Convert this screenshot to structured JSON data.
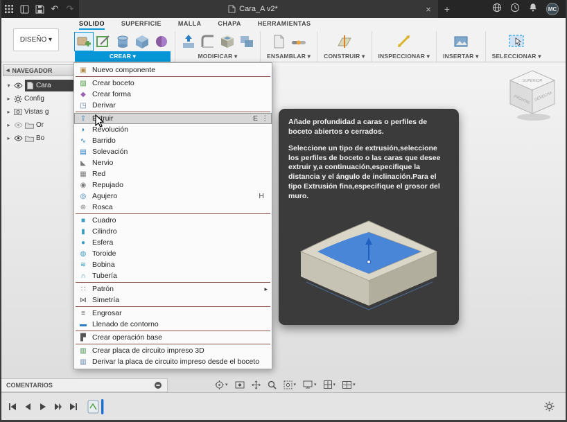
{
  "titlebar": {
    "title": "Cara_A v2*",
    "close": "×",
    "new_tab": "+",
    "avatar": "MC",
    "undo": "↶",
    "redo": "↷"
  },
  "icons": {
    "expand": "▾",
    "collapse": "▸",
    "panel_collapse": "◂",
    "caret": "▾",
    "more": "⋮",
    "submenu": "▸"
  },
  "ribbon": {
    "design_label": "DISEÑO ▾",
    "tabs": [
      {
        "label": "SOLIDO"
      },
      {
        "label": "SUPERFICIE"
      },
      {
        "label": "MALLA"
      },
      {
        "label": "CHAPA"
      },
      {
        "label": "HERRAMIENTAS"
      }
    ],
    "groups": [
      {
        "label": "CREAR ▾"
      },
      {
        "label": "MODIFICAR ▾"
      },
      {
        "label": "ENSAMBLAR ▾"
      },
      {
        "label": "CONSTRUIR ▾"
      },
      {
        "label": "INSPECCIONAR ▾"
      },
      {
        "label": "INSERTAR ▾"
      },
      {
        "label": "SELECCIONAR ▾"
      }
    ]
  },
  "navigator": {
    "title": "NAVEGADOR",
    "items": [
      {
        "label": "Cara"
      },
      {
        "label": "Config"
      },
      {
        "label": "Vistas g"
      },
      {
        "label": "Or"
      },
      {
        "label": "Bo"
      }
    ]
  },
  "create_menu": {
    "items": [
      {
        "label": "Nuevo componente",
        "glyph": "▣",
        "color": "#b08a4a"
      },
      {
        "label": "Crear boceto",
        "glyph": "▨",
        "color": "#4a9b3f"
      },
      {
        "label": "Crear forma",
        "glyph": "◆",
        "color": "#9a62b3"
      },
      {
        "label": "Derivar",
        "glyph": "◳",
        "color": "#5b7fa6"
      },
      {
        "label": "Extruir",
        "glyph": "⇧",
        "color": "#2d7dc2",
        "shortcut": "E"
      },
      {
        "label": "Revolución",
        "glyph": "◗",
        "color": "#2d7dc2"
      },
      {
        "label": "Barrido",
        "glyph": "∿",
        "color": "#2d7dc2"
      },
      {
        "label": "Solevación",
        "glyph": "▤",
        "color": "#2d7dc2"
      },
      {
        "label": "Nervio",
        "glyph": "◣",
        "color": "#7a7a7a"
      },
      {
        "label": "Red",
        "glyph": "▦",
        "color": "#7a7a7a"
      },
      {
        "label": "Repujado",
        "glyph": "◉",
        "color": "#7a7a7a"
      },
      {
        "label": "Agujero",
        "glyph": "◎",
        "color": "#2d7dc2",
        "shortcut": "H"
      },
      {
        "label": "Rosca",
        "glyph": "⊛",
        "color": "#7a7a7a"
      },
      {
        "label": "Cuadro",
        "glyph": "■",
        "color": "#3a9bbf"
      },
      {
        "label": "Cilindro",
        "glyph": "▮",
        "color": "#3a9bbf"
      },
      {
        "label": "Esfera",
        "glyph": "●",
        "color": "#3a9bbf"
      },
      {
        "label": "Toroide",
        "glyph": "◍",
        "color": "#3a9bbf"
      },
      {
        "label": "Bobina",
        "glyph": "≋",
        "color": "#3a9bbf"
      },
      {
        "label": "Tubería",
        "glyph": "∩",
        "color": "#3a9bbf"
      },
      {
        "label": "Patrón",
        "glyph": "∷",
        "color": "#555555"
      },
      {
        "label": "Simetría",
        "glyph": "⋈",
        "color": "#555555"
      },
      {
        "label": "Engrosar",
        "glyph": "≡",
        "color": "#555555"
      },
      {
        "label": "Llenado de contorno",
        "glyph": "▬",
        "color": "#2d7dc2"
      },
      {
        "label": "Crear operación base",
        "glyph": "▛",
        "color": "#555555"
      },
      {
        "label": "Crear placa de circuito impreso 3D",
        "glyph": "▥",
        "color": "#3f8a4a"
      },
      {
        "label": "Derivar la placa de circuito impreso desde el boceto",
        "glyph": "▥",
        "color": "#5b7fa6"
      }
    ]
  },
  "tooltip": {
    "para1": "Añade profundidad a caras o perfiles de boceto abiertos o cerrados.",
    "para2": "Seleccione un tipo de extrusión,seleccione los perfiles de boceto o las caras que desee extruir y,a continuación,especifique la distancia y el ángulo de inclinación.Para el tipo Extrusión fina,especifique el grosor del muro."
  },
  "viewcube": {
    "top": "SUPERIOR",
    "left": "FRONTAL",
    "right": "DERECHA"
  },
  "comments_bar": {
    "label": "COMENTARIOS"
  }
}
